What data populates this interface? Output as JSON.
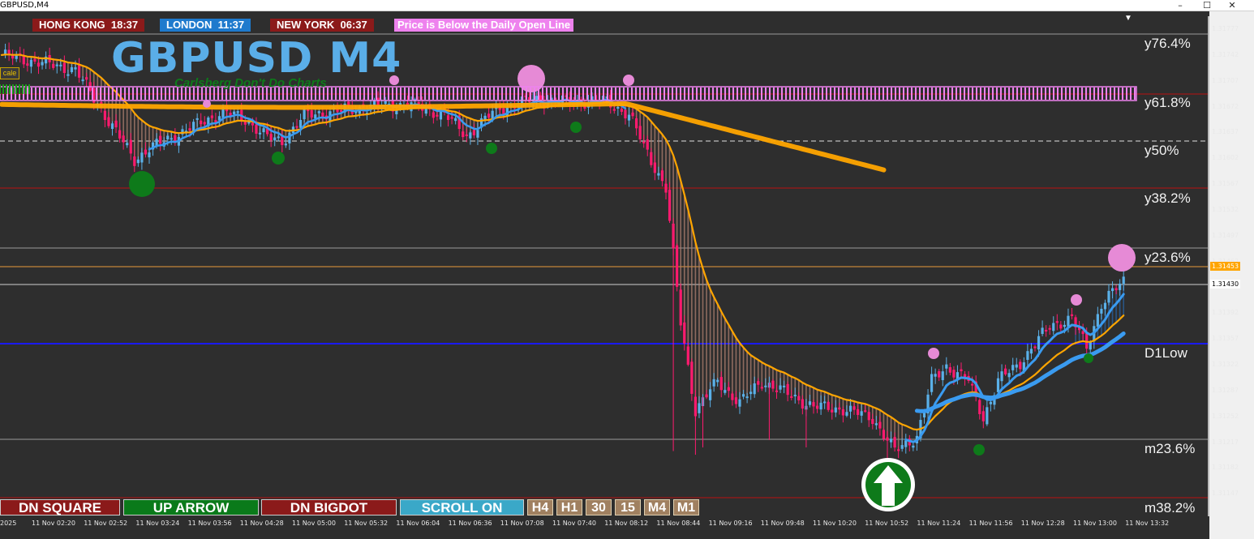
{
  "window": {
    "title": "GBPUSD,M4",
    "min": "–",
    "max": "☐",
    "close": "✕"
  },
  "timezones": [
    {
      "city": "HONG KONG",
      "time": "18:37"
    },
    {
      "city": "LONDON",
      "time": "11:37"
    },
    {
      "city": "NEW YORK",
      "time": "06:37"
    }
  ],
  "alert_message": "Price is Below the Daily Open Line",
  "symbol_label": "GBPUSD M4",
  "watermark": "Carlsberg Don't Do Charts",
  "scale_button": "cale",
  "fib_levels": [
    {
      "label": "y76.4%",
      "price": 1.31755
    },
    {
      "label": "y61.8%",
      "price": 1.31682
    },
    {
      "label": "y50%",
      "price": 1.3162
    },
    {
      "label": "y38.2%",
      "price": 1.31562
    },
    {
      "label": "y23.6%",
      "price": 1.3149
    },
    {
      "label": "D1Low",
      "price": 1.31355
    },
    {
      "label": "m23.6%",
      "price": 1.31225
    },
    {
      "label": "m38.2%",
      "price": 1.31155
    }
  ],
  "buttons": [
    {
      "id": "btn-dnsq",
      "label": "DN SQUARE"
    },
    {
      "id": "btn-up",
      "label": "UP ARROW"
    },
    {
      "id": "btn-dnbig",
      "label": "DN BIGDOT"
    },
    {
      "id": "btn-scroll",
      "label": "SCROLL ON"
    }
  ],
  "timeframes": [
    "H4",
    "H1",
    "30",
    "15",
    "M4",
    "M1"
  ],
  "price_ticks": [
    "1.31777",
    "1.31742",
    "1.31707",
    "1.31672",
    "1.31637",
    "1.31602",
    "1.31567",
    "1.31532",
    "1.31497",
    "1.31462",
    "1.31392",
    "1.31357",
    "1.31322",
    "1.31287",
    "1.31252",
    "1.31217",
    "1.31182",
    "1.31147"
  ],
  "price_labels": {
    "current": "1.31453",
    "last": "1.31430"
  },
  "time_ticks": [
    "2025",
    "11 Nov 02:20",
    "11 Nov 02:52",
    "11 Nov 03:24",
    "11 Nov 03:56",
    "11 Nov 04:28",
    "11 Nov 05:00",
    "11 Nov 05:32",
    "11 Nov 06:04",
    "11 Nov 06:36",
    "11 Nov 07:08",
    "11 Nov 07:40",
    "11 Nov 08:12",
    "11 Nov 08:44",
    "11 Nov 09:16",
    "11 Nov 09:48",
    "11 Nov 10:20",
    "11 Nov 10:52",
    "11 Nov 11:24",
    "11 Nov 11:56",
    "11 Nov 12:28",
    "11 Nov 13:00",
    "11 Nov 13:32"
  ],
  "colors": {
    "background": "#2e2e2e",
    "bear_candle": "#ff1a6e",
    "bull_candle": "#5ab0e8",
    "ma_orange": "#ffa500",
    "ma_blue": "#3a9bf0",
    "daily_open": "#ee82ee",
    "d1_low": "#1a1aff",
    "fib_red": "#8b1a1a"
  },
  "icons": {
    "up_arrow_signal": "up-arrow-icon",
    "top_marker": "triangle-down-icon"
  }
}
